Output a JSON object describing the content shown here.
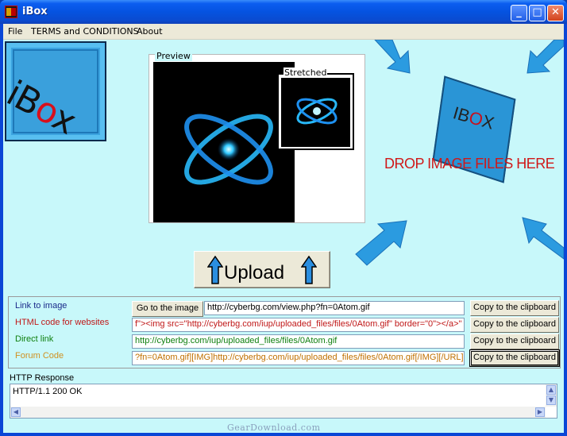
{
  "window": {
    "title": "iBox"
  },
  "menu": {
    "items": [
      "File",
      "TERMS and CONDITIONS",
      "About"
    ]
  },
  "logo": {
    "text_pre": "iB",
    "text_o": "o",
    "text_post": "x"
  },
  "preview": {
    "label": "Preview",
    "stretched_label": "Stretched"
  },
  "dropzone": {
    "text": "DROP IMAGE FILES HERE",
    "box_pre": "IB",
    "box_o": "O",
    "box_post": "X"
  },
  "upload": {
    "label": "Upload"
  },
  "links": {
    "rows": [
      {
        "label": "Link to image",
        "color": "#1a2a8a",
        "value": "http://cyberbg.com/view.php?fn=0Atom.gif",
        "copy": "Copy to the clipboard",
        "value_color": "#000000"
      },
      {
        "label": "HTML code for websites",
        "color": "#c01818",
        "value": "f\"><img src=\"http://cyberbg.com/iup/uploaded_files/files/0Atom.gif\" border=\"0\"></a>\"",
        "copy": "Copy to the clipboard",
        "value_color": "#c01818"
      },
      {
        "label": "Direct link",
        "color": "#108010",
        "value": "http://cyberbg.com/iup/uploaded_files/files/0Atom.gif",
        "copy": "Copy to the clipboard",
        "value_color": "#108010"
      },
      {
        "label": "Forum Code",
        "color": "#d09020",
        "value": "?fn=0Atom.gif][IMG]http://cyberbg.com/iup/uploaded_files/files/0Atom.gif[/IMG][/URL]",
        "copy": "Copy to the clipboard",
        "value_color": "#c07000"
      }
    ],
    "goto_label": "Go to the image"
  },
  "http": {
    "label": "HTTP Response",
    "value": "HTTP/1.1 200 OK"
  },
  "watermark": "GearDownload.com"
}
